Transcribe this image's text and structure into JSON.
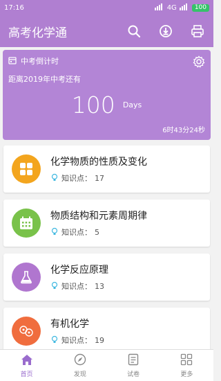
{
  "status": {
    "time": "17:16",
    "network": "4G",
    "battery": "100"
  },
  "header": {
    "title": "高考化学通"
  },
  "countdown": {
    "label": "中考倒计时",
    "subtitle": "距离2019年中考还有",
    "days_value": "100",
    "days_unit": "Days",
    "time_left": "6时43分24秒"
  },
  "topics": [
    {
      "title": "化学物质的性质及变化",
      "meta_label": "知识点：",
      "count": "17",
      "color": "#f3a51e"
    },
    {
      "title": "物质结构和元素周期律",
      "meta_label": "知识点：",
      "count": "5",
      "color": "#79c24a"
    },
    {
      "title": "化学反应原理",
      "meta_label": "知识点：",
      "count": "13",
      "color": "#b076cf"
    },
    {
      "title": "有机化学",
      "meta_label": "知识点：",
      "count": "19",
      "color": "#f06d3e"
    }
  ],
  "nav": {
    "items": [
      {
        "label": "首页"
      },
      {
        "label": "发现"
      },
      {
        "label": "试卷"
      },
      {
        "label": "更多"
      }
    ]
  },
  "colors": {
    "primary": "#b07fd1",
    "accent": "#9a6ccd"
  }
}
